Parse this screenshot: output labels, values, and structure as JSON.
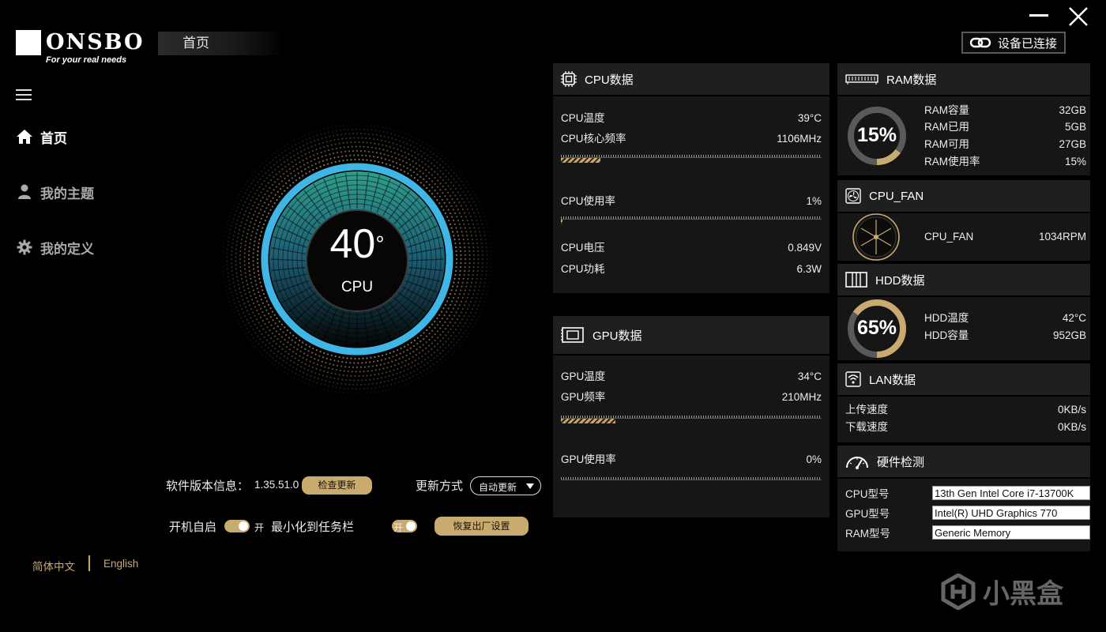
{
  "brand": {
    "name": "ONSBO",
    "tagline": "For your real needs"
  },
  "header": {
    "tab": "首页",
    "connection": "设备已连接"
  },
  "nav": [
    {
      "label": "首页",
      "icon": "home-icon"
    },
    {
      "label": "我的主题",
      "icon": "user-icon"
    },
    {
      "label": "我的定义",
      "icon": "gear-icon"
    }
  ],
  "gauge": {
    "value": "40",
    "unit": "°",
    "label": "CPU",
    "level": 40
  },
  "settings": {
    "version_label": "软件版本信息：",
    "version": "1.35.51.0",
    "check_update": "检查更新",
    "update_mode_label": "更新方式",
    "update_mode": "自动更新",
    "autostart_label": "开机自启",
    "autostart_state": "开",
    "minimize_label": "最小化到任务栏",
    "minimize_state": "开",
    "reset": "恢复出厂设置"
  },
  "language": {
    "zh": "简体中文",
    "en": "English"
  },
  "cpu": {
    "title": "CPU数据",
    "temp_label": "CPU温度",
    "temp": "39°C",
    "freq_label": "CPU核心频率",
    "freq": "1106MHz",
    "freq_level": 0.15,
    "usage_label": "CPU使用率",
    "usage": "1%",
    "usage_level": 0.01,
    "voltage_label": "CPU电压",
    "voltage": "0.849V",
    "power_label": "CPU功耗",
    "power": "6.3W"
  },
  "gpu": {
    "title": "GPU数据",
    "temp_label": "GPU温度",
    "temp": "34°C",
    "freq_label": "GPU频率",
    "freq": "210MHz",
    "freq_level": 0.21,
    "usage_label": "GPU使用率",
    "usage": "0%",
    "usage_level": 0
  },
  "ram": {
    "title": "RAM数据",
    "percent": "15%",
    "level": 0.15,
    "cap_label": "RAM容量",
    "cap": "32GB",
    "used_label": "RAM已用",
    "used": "5GB",
    "free_label": "RAM可用",
    "free": "27GB",
    "usage_label": "RAM使用率",
    "usage": "15%"
  },
  "fan": {
    "title": "CPU_FAN",
    "label": "CPU_FAN",
    "value": "1034RPM"
  },
  "hdd": {
    "title": "HDD数据",
    "percent": "65%",
    "level": 0.65,
    "temp_label": "HDD温度",
    "temp": "42°C",
    "cap_label": "HDD容量",
    "cap": "952GB"
  },
  "lan": {
    "title": "LAN数据",
    "up_label": "上传速度",
    "up": "0KB/s",
    "down_label": "下载速度",
    "down": "0KB/s"
  },
  "hw": {
    "title": "硬件检测",
    "cpu_label": "CPU型号",
    "cpu": "13th Gen Intel Core i7-13700K",
    "gpu_label": "GPU型号",
    "gpu": "Intel(R) UHD Graphics 770",
    "ram_label": "RAM型号",
    "ram": "Generic Memory"
  },
  "colors": {
    "accent": "#c9aa6f",
    "gauge_ring": "#3fb6e6",
    "panel": "#161616"
  },
  "watermark": "小黑盒"
}
